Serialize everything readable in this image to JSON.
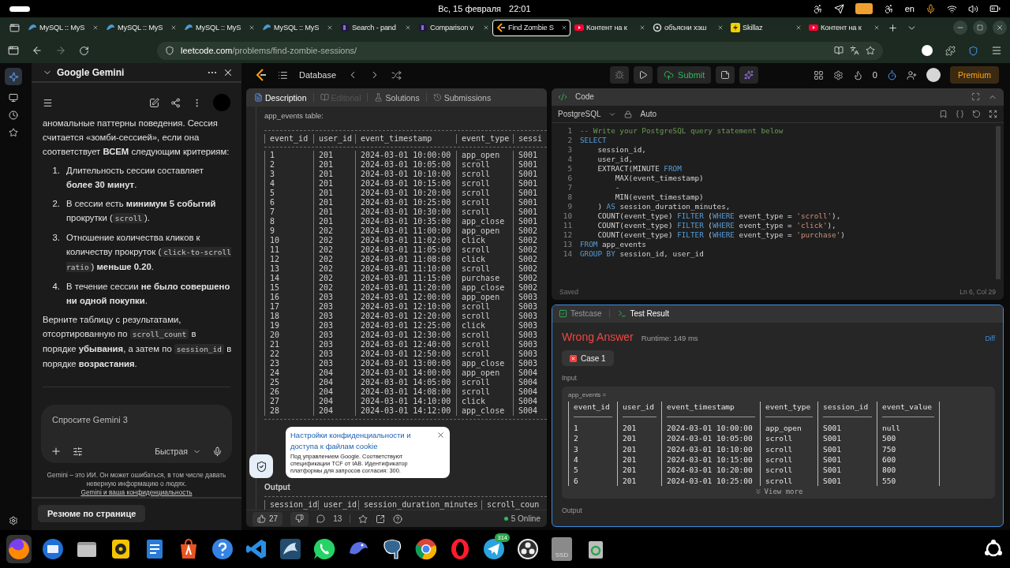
{
  "system_bar": {
    "date": "Вс, 15 февраля",
    "time": "22:01",
    "language": "en"
  },
  "browser": {
    "tabs": [
      {
        "title": "MySQL :: MyS",
        "kind": "db",
        "selected": false
      },
      {
        "title": "MySQL :: MyS",
        "kind": "db",
        "selected": false
      },
      {
        "title": "MySQL :: MyS",
        "kind": "db",
        "selected": false
      },
      {
        "title": "MySQL :: MyS",
        "kind": "db",
        "selected": false
      },
      {
        "title": "Search - pand",
        "kind": "dark",
        "selected": false
      },
      {
        "title": "Comparison v",
        "kind": "dark",
        "selected": false
      },
      {
        "title": "Find Zombie S",
        "kind": "code",
        "selected": true
      },
      {
        "title": "Контент на к",
        "kind": "video",
        "selected": false
      },
      {
        "title": "объясни хэш",
        "kind": "knot",
        "selected": false
      },
      {
        "title": "Skillaz",
        "kind": "bolt",
        "selected": false
      },
      {
        "title": "Контент на к",
        "kind": "video",
        "selected": false
      }
    ],
    "url": {
      "host": "leetcode.com",
      "path": "/problems/find-zombie-sessions/"
    }
  },
  "gemini": {
    "title": "Google Gemini",
    "intro": "аномальные паттерны поведения. Сессия считается «зомби-сессией», если она соответствует **ВСЕМ** следующим критериям:",
    "criteria": [
      {
        "n": "1.",
        "parts": [
          {
            "text": "Длительность сессии составляет **более 30 минут**.",
            "kind": "text"
          }
        ]
      },
      {
        "n": "2.",
        "parts": [
          {
            "text": "В сессии есть **минимум 5 событий** прокрутки (",
            "kind": "text"
          },
          {
            "text": "scroll",
            "kind": "code"
          },
          {
            "text": ").",
            "kind": "text"
          }
        ]
      },
      {
        "n": "3.",
        "parts": [
          {
            "text": "Отношение количества кликов к количеству прокруток (",
            "kind": "text"
          },
          {
            "text": "click-to-scroll ratio",
            "kind": "code"
          },
          {
            "text": ") **меньше 0.20**.",
            "kind": "text"
          }
        ]
      },
      {
        "n": "4.",
        "parts": [
          {
            "text": "В течение сессии **не было совершено ни одной покупки**.",
            "kind": "text"
          }
        ]
      }
    ],
    "closing": [
      {
        "text": "Верните таблицу с результатами, отсортированную по ",
        "kind": "text"
      },
      {
        "text": "scroll_count",
        "kind": "code"
      },
      {
        "text": " в порядке **убывания**, а затем по ",
        "kind": "text"
      },
      {
        "text": "session_id",
        "kind": "code"
      },
      {
        "text": " в порядке **возрастания**.",
        "kind": "text"
      }
    ],
    "prompt": {
      "placeholder": "Спросите Gemini 3",
      "mode": "Быстрая"
    },
    "disclaimer": "Gemini – это ИИ. Он может ошибаться, в том числе давать неверную информацию о людях.",
    "privacy_link": "Gemini и ваша конфиденциальность",
    "summary_button": "Резюме по странице"
  },
  "leetcode": {
    "nav": {
      "section": "Database",
      "submit": "Submit",
      "streak": "0",
      "premium": "Premium"
    },
    "description": {
      "tabs": [
        {
          "label": "Description",
          "selected": true,
          "disabled": false
        },
        {
          "label": "Editorial",
          "selected": false,
          "disabled": true
        },
        {
          "label": "Solutions",
          "selected": false,
          "disabled": false
        },
        {
          "label": "Submissions",
          "selected": false,
          "disabled": false
        }
      ],
      "caption": "app_events table:",
      "columns": [
        "event_id",
        "user_id",
        "event_timestamp",
        "event_type",
        "sessi"
      ],
      "rows": [
        [
          "1",
          "201",
          "2024-03-01 10:00:00",
          "app_open",
          "S001"
        ],
        [
          "2",
          "201",
          "2024-03-01 10:05:00",
          "scroll",
          "S001"
        ],
        [
          "3",
          "201",
          "2024-03-01 10:10:00",
          "scroll",
          "S001"
        ],
        [
          "4",
          "201",
          "2024-03-01 10:15:00",
          "scroll",
          "S001"
        ],
        [
          "5",
          "201",
          "2024-03-01 10:20:00",
          "scroll",
          "S001"
        ],
        [
          "6",
          "201",
          "2024-03-01 10:25:00",
          "scroll",
          "S001"
        ],
        [
          "7",
          "201",
          "2024-03-01 10:30:00",
          "scroll",
          "S001"
        ],
        [
          "8",
          "201",
          "2024-03-01 10:35:00",
          "app_close",
          "S001"
        ],
        [
          "9",
          "202",
          "2024-03-01 11:00:00",
          "app_open",
          "S002"
        ],
        [
          "10",
          "202",
          "2024-03-01 11:02:00",
          "click",
          "S002"
        ],
        [
          "11",
          "202",
          "2024-03-01 11:05:00",
          "scroll",
          "S002"
        ],
        [
          "12",
          "202",
          "2024-03-01 11:08:00",
          "click",
          "S002"
        ],
        [
          "13",
          "202",
          "2024-03-01 11:10:00",
          "scroll",
          "S002"
        ],
        [
          "14",
          "202",
          "2024-03-01 11:15:00",
          "purchase",
          "S002"
        ],
        [
          "15",
          "202",
          "2024-03-01 11:20:00",
          "app_close",
          "S002"
        ],
        [
          "16",
          "203",
          "2024-03-01 12:00:00",
          "app_open",
          "S003"
        ],
        [
          "17",
          "203",
          "2024-03-01 12:10:00",
          "scroll",
          "S003"
        ],
        [
          "18",
          "203",
          "2024-03-01 12:20:00",
          "scroll",
          "S003"
        ],
        [
          "19",
          "203",
          "2024-03-01 12:25:00",
          "click",
          "S003"
        ],
        [
          "20",
          "203",
          "2024-03-01 12:30:00",
          "scroll",
          "S003"
        ],
        [
          "21",
          "203",
          "2024-03-01 12:40:00",
          "scroll",
          "S003"
        ],
        [
          "22",
          "203",
          "2024-03-01 12:50:00",
          "scroll",
          "S003"
        ],
        [
          "23",
          "203",
          "2024-03-01 13:00:00",
          "app_close",
          "S003"
        ],
        [
          "24",
          "204",
          "2024-03-01 14:00:00",
          "app_open",
          "S004"
        ],
        [
          "25",
          "204",
          "2024-03-01 14:05:00",
          "scroll",
          "S004"
        ],
        [
          "26",
          "204",
          "2024-03-01 14:08:00",
          "scroll",
          "S004"
        ],
        [
          "27",
          "204",
          "2024-03-01 14:10:00",
          "click",
          "S004"
        ],
        [
          "28",
          "204",
          "2024-03-01 14:12:00",
          "app_close",
          "S004"
        ]
      ],
      "output_label": "Output",
      "output_columns": [
        "session_id",
        "user_id",
        "session_duration_minutes",
        "scroll_coun"
      ],
      "likes": "27",
      "comments": "13",
      "online": "5 Online"
    },
    "cookie_notice": {
      "title": "Настройки конфиденциальности и доступа к файлам cookie",
      "body": "Под управлением Google. Соответствуют спецификации TCF от IAB. Идентификатор платформы для запросов согласия: 300."
    },
    "code": {
      "title": "Code",
      "language": "PostgreSQL",
      "mode": "Auto",
      "lines": [
        {
          "n": "1",
          "tokens": [
            {
              "text": "-- Write your PostgreSQL query statement below",
              "kind": "comment"
            }
          ]
        },
        {
          "n": "2",
          "tokens": [
            {
              "text": "SELECT",
              "kind": "keyword"
            }
          ]
        },
        {
          "n": "3",
          "tokens": [
            {
              "text": "    session_id,",
              "kind": "plain"
            }
          ]
        },
        {
          "n": "4",
          "tokens": [
            {
              "text": "    user_id,",
              "kind": "plain"
            }
          ]
        },
        {
          "n": "5",
          "tokens": [
            {
              "text": "    EXTRACT(MINUTE ",
              "kind": "plain"
            },
            {
              "text": "FROM",
              "kind": "keyword"
            }
          ]
        },
        {
          "n": "6",
          "tokens": [
            {
              "text": "        MAX(event_timestamp)",
              "kind": "plain"
            }
          ]
        },
        {
          "n": "7",
          "tokens": [
            {
              "text": "        -",
              "kind": "plain"
            }
          ]
        },
        {
          "n": "8",
          "tokens": [
            {
              "text": "        MIN(event_timestamp)",
              "kind": "plain"
            }
          ]
        },
        {
          "n": "9",
          "tokens": [
            {
              "text": "    ) ",
              "kind": "plain"
            },
            {
              "text": "AS",
              "kind": "keyword"
            },
            {
              "text": " session_duration_minutes,",
              "kind": "plain"
            }
          ]
        },
        {
          "n": "10",
          "tokens": [
            {
              "text": "    COUNT(event_type) ",
              "kind": "plain"
            },
            {
              "text": "FILTER",
              "kind": "keyword"
            },
            {
              "text": " (",
              "kind": "plain"
            },
            {
              "text": "WHERE",
              "kind": "keyword"
            },
            {
              "text": " event_type = ",
              "kind": "plain"
            },
            {
              "text": "'scroll'",
              "kind": "string"
            },
            {
              "text": "),",
              "kind": "plain"
            }
          ]
        },
        {
          "n": "11",
          "tokens": [
            {
              "text": "    COUNT(event_type) ",
              "kind": "plain"
            },
            {
              "text": "FILTER",
              "kind": "keyword"
            },
            {
              "text": " (",
              "kind": "plain"
            },
            {
              "text": "WHERE",
              "kind": "keyword"
            },
            {
              "text": " event_type = ",
              "kind": "plain"
            },
            {
              "text": "'click'",
              "kind": "string"
            },
            {
              "text": "),",
              "kind": "plain"
            }
          ]
        },
        {
          "n": "12",
          "tokens": [
            {
              "text": "    COUNT(event_type) ",
              "kind": "plain"
            },
            {
              "text": "FILTER",
              "kind": "keyword"
            },
            {
              "text": " (",
              "kind": "plain"
            },
            {
              "text": "WHERE",
              "kind": "keyword"
            },
            {
              "text": " event_type = ",
              "kind": "plain"
            },
            {
              "text": "'purchase'",
              "kind": "string"
            },
            {
              "text": ")",
              "kind": "plain"
            }
          ]
        },
        {
          "n": "13",
          "tokens": [
            {
              "text": "FROM",
              "kind": "keyword"
            },
            {
              "text": " app_events",
              "kind": "plain"
            }
          ]
        },
        {
          "n": "14",
          "tokens": [
            {
              "text": "GROUP BY",
              "kind": "keyword"
            },
            {
              "text": " session_id, user_id",
              "kind": "plain"
            }
          ]
        }
      ],
      "status": "Saved",
      "cursor": "Ln 6, Col 29"
    },
    "test": {
      "tabs": [
        {
          "label": "Testcase",
          "selected": false
        },
        {
          "label": "Test Result",
          "selected": true
        }
      ],
      "verdict": "Wrong Answer",
      "runtime": "Runtime: 149 ms",
      "diff": "Diff",
      "cases": [
        {
          "label": "Case 1",
          "passed": false
        }
      ],
      "input_label": "Input",
      "variable": "app_events =",
      "columns": [
        "event_id",
        "user_id",
        "event_timestamp",
        "event_type",
        "session_id",
        "event_value"
      ],
      "rows": [
        [
          "1",
          "201",
          "2024-03-01 10:00:00",
          "app_open",
          "S001",
          "null"
        ],
        [
          "2",
          "201",
          "2024-03-01 10:05:00",
          "scroll",
          "S001",
          "500"
        ],
        [
          "3",
          "201",
          "2024-03-01 10:10:00",
          "scroll",
          "S001",
          "750"
        ],
        [
          "4",
          "201",
          "2024-03-01 10:15:00",
          "scroll",
          "S001",
          "600"
        ],
        [
          "5",
          "201",
          "2024-03-01 10:20:00",
          "scroll",
          "S001",
          "800"
        ],
        [
          "6",
          "201",
          "2024-03-01 10:25:00",
          "scroll",
          "S001",
          "550"
        ]
      ],
      "view_more": "View more",
      "output_label": "Output"
    }
  },
  "dock": {
    "badge": "314",
    "drive_label": "SSD"
  }
}
